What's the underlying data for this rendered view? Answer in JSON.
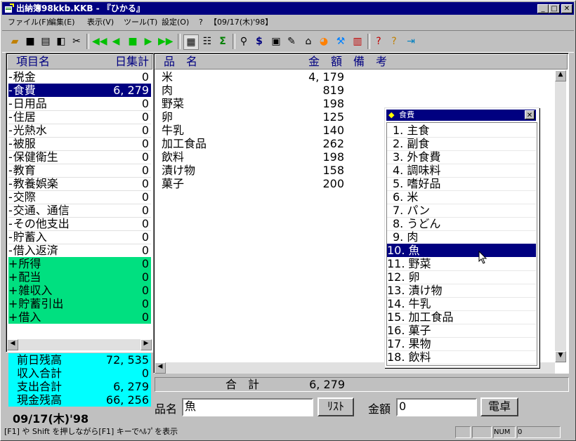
{
  "window": {
    "title": "出納簿98kkb.KKB - 『ひかる』"
  },
  "menu": [
    "ファイル(F)",
    "編集(E)",
    "表示(V)",
    "ツール(T)",
    "設定(O)",
    "?",
    "【09/17(木)'98】"
  ],
  "left_header": {
    "col1": "項目名",
    "col2": "日集計"
  },
  "left_items": [
    {
      "prefix": "-",
      "name": "税金",
      "value": "0"
    },
    {
      "prefix": "-",
      "name": "食費",
      "value": "6, 279"
    },
    {
      "prefix": "-",
      "name": "日用品",
      "value": "0"
    },
    {
      "prefix": "-",
      "name": "住居",
      "value": "0"
    },
    {
      "prefix": "-",
      "name": "光熱水",
      "value": "0"
    },
    {
      "prefix": "-",
      "name": "被服",
      "value": "0"
    },
    {
      "prefix": "-",
      "name": "保健衛生",
      "value": "0"
    },
    {
      "prefix": "-",
      "name": "教育",
      "value": "0"
    },
    {
      "prefix": "-",
      "name": "教養娯楽",
      "value": "0"
    },
    {
      "prefix": "-",
      "name": "交際",
      "value": "0"
    },
    {
      "prefix": "-",
      "name": "交通、通信",
      "value": "0"
    },
    {
      "prefix": "-",
      "name": "その他支出",
      "value": "0"
    },
    {
      "prefix": "-",
      "name": "貯蓄入",
      "value": "0"
    },
    {
      "prefix": "-",
      "name": "借入返済",
      "value": "0"
    },
    {
      "prefix": "+",
      "name": "所得",
      "value": "0"
    },
    {
      "prefix": "+",
      "name": "配当",
      "value": "0"
    },
    {
      "prefix": "+",
      "name": "雑収入",
      "value": "0"
    },
    {
      "prefix": "+",
      "name": "貯蓄引出",
      "value": "0"
    },
    {
      "prefix": "+",
      "name": "借入",
      "value": "0"
    }
  ],
  "summary": [
    {
      "name": "前日残高",
      "value": "72, 535"
    },
    {
      "name": "収入合計",
      "value": "0"
    },
    {
      "name": "支出合計",
      "value": "6, 279"
    },
    {
      "name": "現金残高",
      "value": "66, 256"
    }
  ],
  "date_label": "09/17(木)'98",
  "right_header": {
    "col1": "品　名",
    "col2": "金　額",
    "col3": "備　考"
  },
  "right_items": [
    {
      "name": "米",
      "value": "4, 179"
    },
    {
      "name": "肉",
      "value": "819"
    },
    {
      "name": "野菜",
      "value": "198"
    },
    {
      "name": "卵",
      "value": "125"
    },
    {
      "name": "牛乳",
      "value": "140"
    },
    {
      "name": "加工食品",
      "value": "262"
    },
    {
      "name": "飲料",
      "value": "198"
    },
    {
      "name": "漬け物",
      "value": "158"
    },
    {
      "name": "菓子",
      "value": "200"
    }
  ],
  "total": {
    "label": "合　計",
    "value": "6, 279"
  },
  "popup": {
    "title": "食費",
    "items": [
      "1. 主食",
      "2. 副食",
      "3. 外食費",
      "4. 調味料",
      "5. 嗜好品",
      "6. 米",
      "7. パン",
      "8. うどん",
      "9. 肉",
      "10. 魚",
      "11. 野菜",
      "12. 卵",
      "13. 漬け物",
      "14. 牛乳",
      "15. 加工食品",
      "16. 菓子",
      "17. 果物",
      "18. 飲料"
    ],
    "selected_index": 9
  },
  "entry": {
    "name_label": "品名",
    "name_value": "魚",
    "list_button": "ﾘｽﾄ",
    "amount_label": "金額",
    "amount_value": "0",
    "calc_button": "電卓"
  },
  "status": {
    "help": "[F1] や Shift を押しながら[F1] キーでﾍﾙﾌﾟを表示",
    "num": "NUM",
    "extra": "0"
  }
}
